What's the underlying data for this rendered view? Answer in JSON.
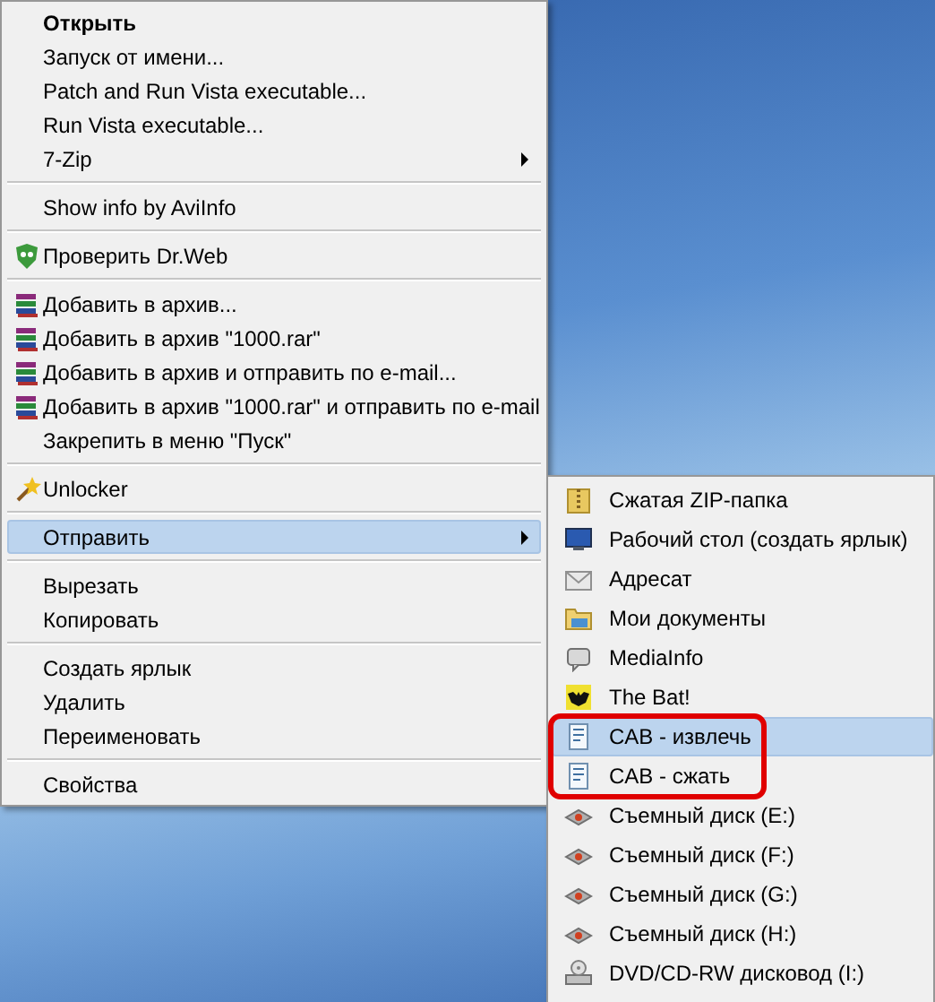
{
  "context_menu": {
    "items": [
      {
        "kind": "default",
        "label": "Открыть",
        "selected": false
      },
      {
        "kind": "plain",
        "label": "Запуск от имени...",
        "selected": false
      },
      {
        "kind": "plain",
        "label": "Patch and Run Vista executable...",
        "selected": false
      },
      {
        "kind": "plain",
        "label": "Run Vista executable...",
        "selected": false
      },
      {
        "kind": "submenu",
        "label": "7-Zip",
        "selected": false
      },
      {
        "kind": "separator"
      },
      {
        "kind": "plain",
        "label": "Show info by AviInfo",
        "selected": false
      },
      {
        "kind": "separator"
      },
      {
        "kind": "plain",
        "label": "Проверить Dr.Web",
        "selected": false
      },
      {
        "kind": "separator"
      },
      {
        "kind": "plain",
        "label": "Добавить в архив...",
        "selected": false
      },
      {
        "kind": "plain",
        "label": "Добавить в архив \"1000.rar\"",
        "selected": false
      },
      {
        "kind": "plain",
        "label": "Добавить в архив и отправить по e-mail...",
        "selected": false
      },
      {
        "kind": "plain",
        "label": "Добавить в архив \"1000.rar\" и отправить по e-mail",
        "selected": false
      },
      {
        "kind": "plain",
        "label": "Закрепить в меню \"Пуск\"",
        "selected": false
      },
      {
        "kind": "separator"
      },
      {
        "kind": "plain",
        "label": "Unlocker",
        "selected": false
      },
      {
        "kind": "separator"
      },
      {
        "kind": "submenu",
        "label": "Отправить",
        "selected": true
      },
      {
        "kind": "separator"
      },
      {
        "kind": "plain",
        "label": "Вырезать",
        "selected": false
      },
      {
        "kind": "plain",
        "label": "Копировать",
        "selected": false
      },
      {
        "kind": "separator"
      },
      {
        "kind": "plain",
        "label": "Создать ярлык",
        "selected": false
      },
      {
        "kind": "plain",
        "label": "Удалить",
        "selected": false
      },
      {
        "kind": "plain",
        "label": "Переименовать",
        "selected": false
      },
      {
        "kind": "separator"
      },
      {
        "kind": "plain",
        "label": "Свойства",
        "selected": false
      }
    ]
  },
  "send_to_submenu": {
    "items": [
      {
        "label": "Сжатая ZIP-папка",
        "selected": false,
        "circled": false
      },
      {
        "label": "Рабочий стол (создать ярлык)",
        "selected": false,
        "circled": false
      },
      {
        "label": "Адресат",
        "selected": false,
        "circled": false
      },
      {
        "label": "Мои документы",
        "selected": false,
        "circled": false
      },
      {
        "label": "MediaInfo",
        "selected": false,
        "circled": false
      },
      {
        "label": "The Bat!",
        "selected": false,
        "circled": false
      },
      {
        "label": "CAB - извлечь",
        "selected": true,
        "circled": true
      },
      {
        "label": "CAB - сжать",
        "selected": false,
        "circled": true
      },
      {
        "label": "Съемный диск (E:)",
        "selected": false,
        "circled": false
      },
      {
        "label": "Съемный диск (F:)",
        "selected": false,
        "circled": false
      },
      {
        "label": "Съемный диск (G:)",
        "selected": false,
        "circled": false
      },
      {
        "label": "Съемный диск (H:)",
        "selected": false,
        "circled": false
      },
      {
        "label": "DVD/CD-RW дисковод (I:)",
        "selected": false,
        "circled": false
      }
    ]
  }
}
